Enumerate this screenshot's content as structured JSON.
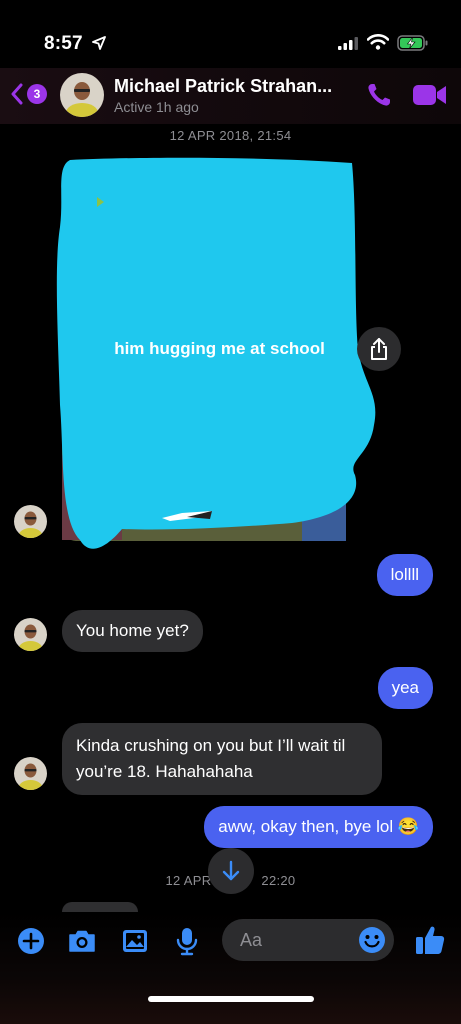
{
  "status_bar": {
    "time": "8:57"
  },
  "header": {
    "back_count": "3",
    "contact_name": "Michael Patrick Strahan...",
    "contact_status": "Active 1h ago"
  },
  "timestamps": {
    "first": "12 APR 2018, 21:54",
    "second_left": "12 APR",
    "second_right": "22:20"
  },
  "photo": {
    "caption": "him hugging me at school",
    "redaction_color": "#1fc8ee"
  },
  "messages": [
    {
      "side": "outgoing",
      "text": "lollll"
    },
    {
      "side": "incoming",
      "text": "You home yet?"
    },
    {
      "side": "outgoing",
      "text": "yea"
    },
    {
      "side": "incoming",
      "text": "Kinda crushing on you but I’ll wait til you’re 18. Hahahahaha"
    },
    {
      "side": "outgoing",
      "text": "aww, okay then, bye lol 😂"
    }
  ],
  "composer": {
    "placeholder": "Aa"
  },
  "colors": {
    "accent": "#9b35e8",
    "outgoing_bubble": "#4a62f0",
    "incoming_bubble": "#2f2f31",
    "composer_icon": "#3b8cf7"
  }
}
